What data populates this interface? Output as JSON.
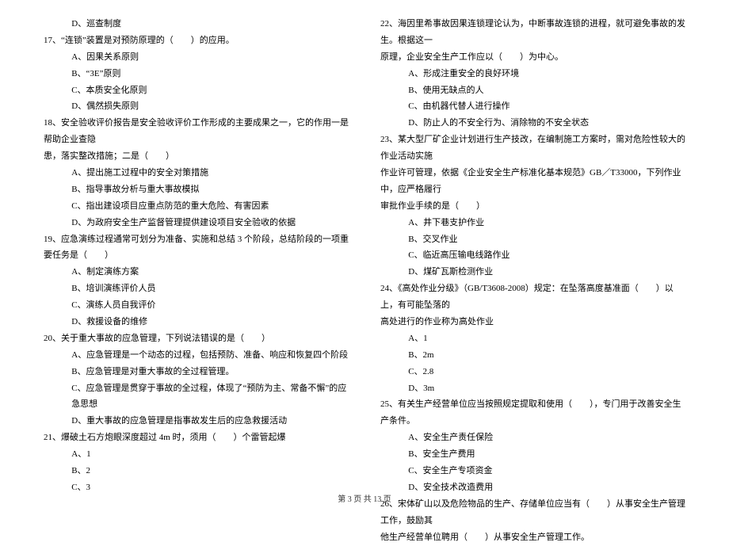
{
  "left": {
    "q16_d": "D、巡查制度",
    "q17": "17、“连锁”装置是对预防原理的（　　）的应用。",
    "q17_a": "A、因果关系原则",
    "q17_b": "B、“3E”原则",
    "q17_c": "C、本质安全化原则",
    "q17_d": "D、偶然损失原则",
    "q18": "18、安全验收评价报告是安全验收评价工作形成的主要成果之一，它的作用一是帮助企业查隐",
    "q18_cont": "患，落实整改措施；二是（　　）",
    "q18_a": "A、提出施工过程中的安全对策措施",
    "q18_b": "B、指导事故分析与重大事故模拟",
    "q18_c": "C、指出建设项目应重点防范的重大危险、有害因素",
    "q18_d": "D、为政府安全生产监督管理提供建设项目安全验收的依据",
    "q19": "19、应急演练过程通常可划分为准备、实施和总结 3 个阶段，总结阶段的一项重要任务是（　　）",
    "q19_a": "A、制定演练方案",
    "q19_b": "B、培训演练评价人员",
    "q19_c": "C、演练人员自我评价",
    "q19_d": "D、救援设备的维修",
    "q20": "20、关于重大事故的应急管理，下列说法错误的是（　　）",
    "q20_a": "A、应急管理是一个动态的过程，包括预防、准备、响应和恢复四个阶段",
    "q20_b": "B、应急管理是对重大事故的全过程管理。",
    "q20_c": "C、应急管理是贯穿于事故的全过程，体现了“预防为主、常备不懈”的应急思想",
    "q20_d": "D、重大事故的应急管理是指事故发生后的应急救援活动",
    "q21": "21、爆破土石方炮眼深度超过 4m 时，须用（　　）个雷管起爆",
    "q21_a": "A、1",
    "q21_b": "B、2",
    "q21_c": "C、3"
  },
  "right": {
    "q22": "22、海因里希事故因果连锁理论认为，中断事故连锁的进程，就可避免事故的发生。根据这一",
    "q22_cont": "原理，企业安全生产工作应以（　　）为中心。",
    "q22_a": "A、形成注重安全的良好环境",
    "q22_b": "B、使用无缺点的人",
    "q22_c": "C、由机器代替人进行操作",
    "q22_d": "D、防止人的不安全行为、消除物的不安全状态",
    "q23": "23、某大型厂矿企业计划进行生产技改，在编制施工方案时，需对危险性较大的作业活动实施",
    "q23_cont1": "作业许可管理，依据《企业安全生产标准化基本规范》GB／T33000，下列作业中，应严格履行",
    "q23_cont2": "审批作业手续的是（　　）",
    "q23_a": "A、井下巷支护作业",
    "q23_b": "B、交叉作业",
    "q23_c": "C、临近高压输电线路作业",
    "q23_d": "D、煤矿瓦斯检测作业",
    "q24": "24、《高处作业分级》（GB/T3608-2008）规定：在坠落高度基准面（　　）以上，有可能坠落的",
    "q24_cont": "高处进行的作业称为高处作业",
    "q24_a": "A、1",
    "q24_b": "B、2m",
    "q24_c": "C、2.8",
    "q24_d": "D、3m",
    "q25": "25、有关生产经营单位应当按照规定提取和使用（　　），专门用于改善安全生产条件。",
    "q25_a": "A、安全生产责任保险",
    "q25_b": "B、安全生产费用",
    "q25_c": "C、安全生产专项资金",
    "q25_d": "D、安全技术改造费用",
    "q26": "26、宋体矿山以及危险物品的生产、存储单位应当有（　　）从事安全生产管理工作，鼓励其",
    "q26_cont": "他生产经营单位聘用（　　）从事安全生产管理工作。"
  },
  "footer": "第 3 页 共 13 页"
}
